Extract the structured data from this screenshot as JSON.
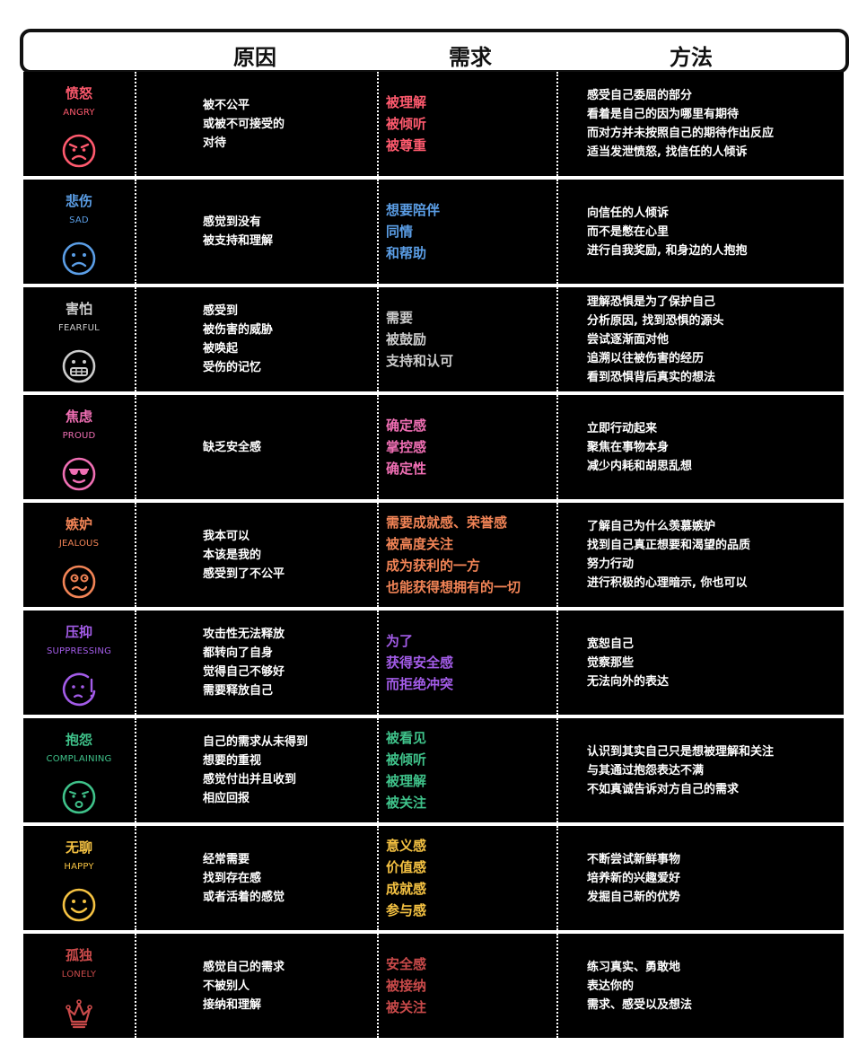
{
  "header": {
    "col_reason": "原因",
    "col_need": "需求",
    "col_method": "方法"
  },
  "rows": [
    {
      "name": "愤怒",
      "en": "ANGRY",
      "color": "#ff5a6e",
      "icon": "angry-face-icon",
      "reason": [
        "被不公平",
        "或被不可接受的",
        "对待"
      ],
      "need": [
        "被理解",
        "被倾听",
        "被尊重"
      ],
      "method": [
        "感受自己委屈的部分",
        "看着是自己的因为哪里有期待",
        "而对方并未按照自己的期待作出反应",
        "适当发泄愤怒, 找信任的人倾诉"
      ]
    },
    {
      "name": "悲伤",
      "en": "SAD",
      "color": "#5b9ee6",
      "icon": "sad-face-icon",
      "reason": [
        "感觉到没有",
        "被支持和理解"
      ],
      "need": [
        "想要陪伴",
        "同情",
        "和帮助"
      ],
      "method": [
        "向信任的人倾诉",
        "而不是憋在心里",
        "进行自我奖励, 和身边的人抱抱"
      ]
    },
    {
      "name": "害怕",
      "en": "FEARFUL",
      "color": "#cccccc",
      "icon": "fearful-face-icon",
      "reason": [
        "感受到",
        "被伤害的威胁",
        "被唤起",
        "受伤的记忆"
      ],
      "need": [
        "需要",
        "被鼓励",
        "支持和认可"
      ],
      "method": [
        "理解恐惧是为了保护自己",
        "分析原因, 找到恐惧的源头",
        "尝试逐渐面对他",
        "追溯以往被伤害的经历",
        "看到恐惧背后真实的想法"
      ]
    },
    {
      "name": "焦虑",
      "en": "PROUD",
      "color": "#f06fb4",
      "icon": "sunglasses-face-icon",
      "reason": [
        "缺乏安全感"
      ],
      "need": [
        "确定感",
        "掌控感",
        "确定性"
      ],
      "method": [
        "立即行动起来",
        "聚焦在事物本身",
        "减少内耗和胡思乱想"
      ]
    },
    {
      "name": "嫉妒",
      "en": "JEALOUS",
      "color": "#f28456",
      "icon": "jealous-face-icon",
      "reason": [
        "我本可以",
        "本该是我的",
        "感受到了不公平"
      ],
      "need": [
        "需要成就感、荣誉感",
        "被高度关注",
        "成为获利的一方",
        "也能获得想拥有的一切"
      ],
      "method": [
        "了解自己为什么羡慕嫉妒",
        "找到自己真正想要和渴望的品质",
        "努力行动",
        "进行积极的心理暗示, 你也可以"
      ]
    },
    {
      "name": "压抑",
      "en": "SUPPRESSING",
      "color": "#a35ce8",
      "icon": "suppressed-face-icon",
      "reason": [
        "攻击性无法释放",
        "都转向了自身",
        "觉得自己不够好",
        "需要释放自己"
      ],
      "need": [
        "为了",
        "获得安全感",
        "而拒绝冲突"
      ],
      "method": [
        "宽恕自己",
        "觉察那些",
        "无法向外的表达"
      ]
    },
    {
      "name": "抱怨",
      "en": "COMPLAINING",
      "color": "#3fc28a",
      "icon": "complaining-face-icon",
      "reason": [
        "自己的需求从未得到",
        "想要的重视",
        "感觉付出并且收到",
        "相应回报"
      ],
      "need": [
        "被看见",
        "被倾听",
        "被理解",
        "被关注"
      ],
      "method": [
        "认识到其实自己只是想被理解和关注",
        "与其通过抱怨表达不满",
        "不如真诚告诉对方自己的需求"
      ]
    },
    {
      "name": "无聊",
      "en": "HAPPY",
      "color": "#f5c242",
      "icon": "smile-face-icon",
      "reason": [
        "经常需要",
        "找到存在感",
        "或者活着的感觉"
      ],
      "need": [
        "意义感",
        "价值感",
        "成就感",
        "参与感"
      ],
      "method": [
        "不断尝试新鲜事物",
        "培养新的兴趣爱好",
        "发掘自己新的优势"
      ]
    },
    {
      "name": "孤独",
      "en": "LONELY",
      "color": "#c94a4a",
      "icon": "crown-icon",
      "reason": [
        "感觉自己的需求",
        "不被别人",
        "接纳和理解"
      ],
      "need": [
        "安全感",
        "被接纳",
        "被关注"
      ],
      "method": [
        "练习真实、勇敢地",
        "表达你的",
        "需求、感受以及想法"
      ]
    }
  ]
}
